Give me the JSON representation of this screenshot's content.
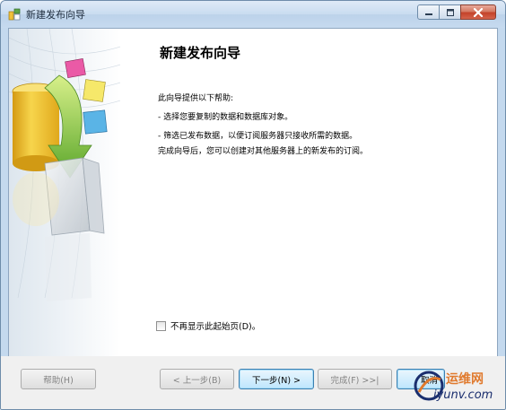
{
  "window": {
    "title": "新建发布向导"
  },
  "page": {
    "heading": "新建发布向导",
    "intro": "此向导提供以下帮助:",
    "bullets": [
      "- 选择您要复制的数据和数据库对象。",
      "- 筛选已发布数据，以便订阅服务器只接收所需的数据。"
    ],
    "closing": "完成向导后，您可以创建对其他服务器上的新发布的订阅。",
    "checkbox_label": "不再显示此起始页(D)。"
  },
  "buttons": {
    "help": "帮助(H)",
    "back": "< 上一步(B)",
    "next": "下一步(N) >",
    "finish": "完成(F) >>|",
    "cancel": "取消"
  },
  "watermark": {
    "line1": "运维网",
    "line2": "iyunv.com"
  },
  "colors": {
    "accent": "#3c7fb1",
    "titlebar": "#c9dcf0",
    "close": "#c4432a"
  }
}
